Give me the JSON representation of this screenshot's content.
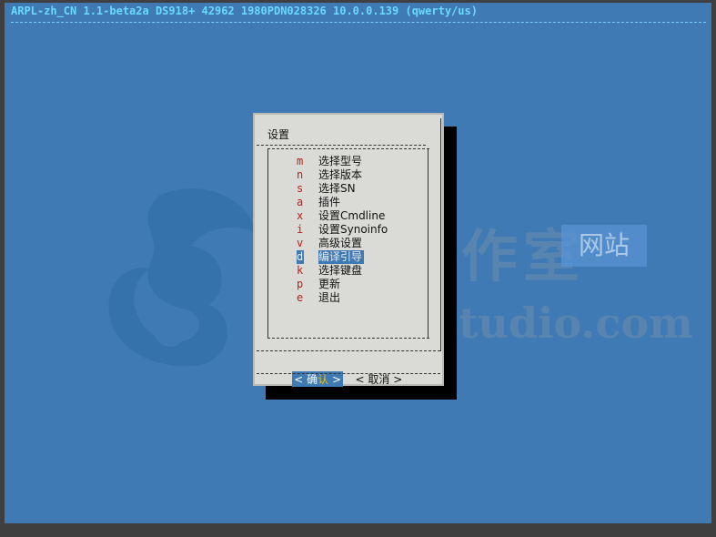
{
  "titlebar": {
    "text": "ARPL-zh_CN 1.1-beta2a DS918+ 42962 1980PDN028326 10.0.0.139 (qwerty/us)"
  },
  "watermark": {
    "cn_text": "腾龙工作室",
    "badge_text": "网站",
    "en_text": "Tenlonstudio.com"
  },
  "dialog": {
    "title": "设置",
    "items": [
      {
        "key": "m",
        "label": "选择型号"
      },
      {
        "key": "n",
        "label": "选择版本"
      },
      {
        "key": "s",
        "label": "选择SN"
      },
      {
        "key": "a",
        "label": "插件"
      },
      {
        "key": "x",
        "label": "设置Cmdline"
      },
      {
        "key": "i",
        "label": "设置Synoinfo"
      },
      {
        "key": "v",
        "label": "高级设置"
      },
      {
        "key": "d",
        "label": "编译引导"
      },
      {
        "key": "k",
        "label": "选择键盘"
      },
      {
        "key": "p",
        "label": "更新"
      },
      {
        "key": "e",
        "label": "退出"
      }
    ],
    "selected_index": 7,
    "buttons": {
      "ok_left": "<",
      "ok_label_first": "确",
      "ok_label_rest": "认",
      "ok_right": ">",
      "cancel_left": "<",
      "cancel_label": "取消",
      "cancel_right": ">"
    }
  },
  "colors": {
    "screen_bg": "#3f7ab4",
    "title_text": "#6ad9ff",
    "dialog_bg": "#dadad6",
    "hotkey": "#c0201c",
    "selection_bg": "#3f7ab4"
  }
}
